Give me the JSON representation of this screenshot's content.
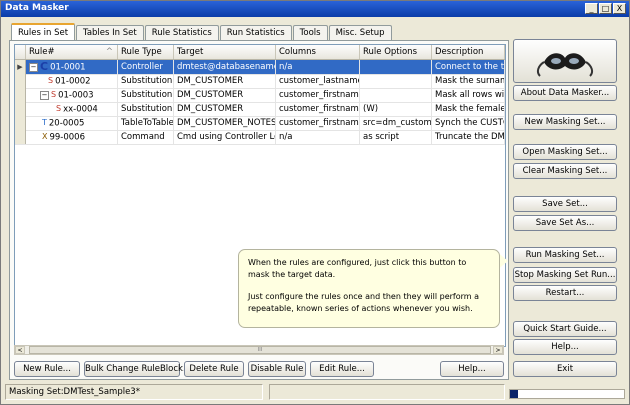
{
  "window": {
    "title": "Data Masker",
    "btn_min": "_",
    "btn_max": "□",
    "btn_close": "X"
  },
  "tabs": [
    {
      "label": "Rules in Set",
      "active": true
    },
    {
      "label": "Tables In Set"
    },
    {
      "label": "Rule Statistics"
    },
    {
      "label": "Run Statistics"
    },
    {
      "label": "Tools"
    },
    {
      "label": "Misc. Setup"
    }
  ],
  "grid": {
    "headers": [
      "Rule#",
      "Rule Type",
      "Target",
      "Columns",
      "Rule Options",
      "Description"
    ],
    "sort_glyph": "^",
    "rows": [
      {
        "rule": "01-0001",
        "type": "Controller",
        "target": "dmtest@databasename",
        "columns": "n/a",
        "options": "",
        "desc": "Connect to the targ",
        "selected": true,
        "indicator": "▶",
        "tree": "−",
        "icon": "C"
      },
      {
        "rule": "01-0002",
        "type": "Substitution",
        "target": "DM_CUSTOMER",
        "columns": "customer_lastname",
        "options": "",
        "desc": "Mask the surnames",
        "icon": "S"
      },
      {
        "rule": "01-0003",
        "type": "Substitution",
        "target": "DM_CUSTOMER",
        "columns": "customer_firstname",
        "options": "",
        "desc": "Mask all rows with m",
        "tree": "−",
        "icon": "S"
      },
      {
        "rule": "xx-0004",
        "type": "Substitution",
        "target": "DM_CUSTOMER",
        "columns": "customer_firstname",
        "options": "(W)",
        "desc": "Mask the female cus",
        "icon": "S"
      },
      {
        "rule": "20-0005",
        "type": "TableToTable",
        "target": "DM_CUSTOMER_NOTES",
        "columns": "customer_firstname,...",
        "options": "src=dm_customer",
        "desc": "Synch the CUSTOM",
        "icon": "T"
      },
      {
        "rule": "99-0006",
        "type": "Command",
        "target": "Cmd using Controller Login",
        "columns": "n/a",
        "options": "as script",
        "desc": "Truncate the DM_EN",
        "icon": "X"
      }
    ]
  },
  "scroll": {
    "left": "<",
    "right": ">",
    "thumb": "III"
  },
  "bottom_buttons": [
    "New Rule...",
    "Bulk Change RuleBlock...",
    "Delete Rule",
    "Disable Rule",
    "Edit Rule...",
    "Help..."
  ],
  "side_buttons": {
    "about": "About Data Masker...",
    "new_set": "New Masking Set...",
    "open_set": "Open Masking Set...",
    "clear_set": "Clear Masking Set...",
    "save_set": "Save Set...",
    "save_as": "Save Set As...",
    "run_set": "Run Masking Set...",
    "stop_run": "Stop Masking Set Run...",
    "restart": "Restart...",
    "quick_start": "Quick Start Guide...",
    "help": "Help...",
    "exit": "Exit"
  },
  "tooltip": {
    "line1": "When the rules are configured, just click this button to",
    "line2": "mask the target data.",
    "line3": "Just configure the rules once and then they will perform a",
    "line4": "repeatable, known series of actions whenever you wish."
  },
  "status": {
    "masking_set": "Masking Set:DMTest_Sample3*",
    "progress_fraction": 0.07
  },
  "colors": {
    "selection": "#316ac5",
    "titlebar": "#0a3ca8",
    "tooltip_bg": "#ffffe1"
  }
}
